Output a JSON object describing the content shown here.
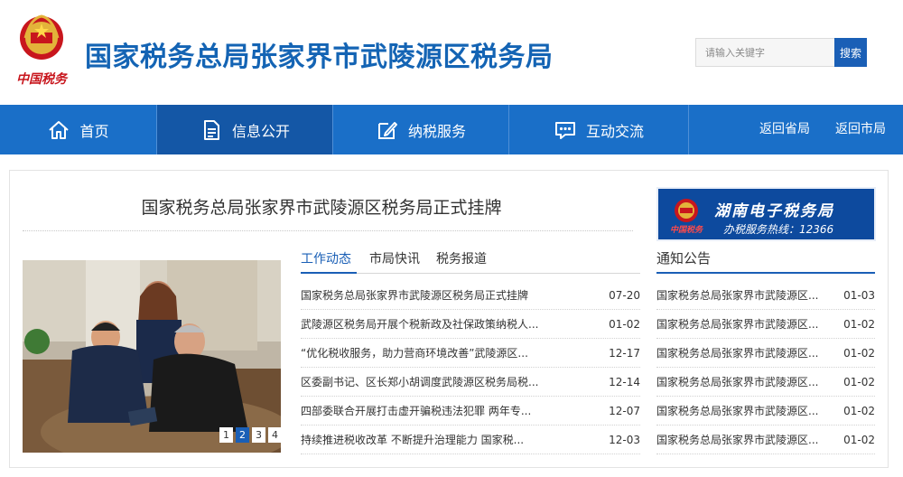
{
  "header": {
    "emblem_text": "中国税务",
    "title": "国家税务总局张家界市武陵源区税务局",
    "search_placeholder": "请输入关键字",
    "search_button": "搜索"
  },
  "nav": {
    "items": [
      {
        "label": "首页",
        "icon": "home-icon"
      },
      {
        "label": "信息公开",
        "icon": "document-icon"
      },
      {
        "label": "纳税服务",
        "icon": "edit-icon"
      },
      {
        "label": "互动交流",
        "icon": "chat-icon"
      }
    ],
    "links": [
      "返回省局",
      "返回市局"
    ]
  },
  "main": {
    "headline": "国家税务总局张家界市武陵源区税务局正式挂牌",
    "banner": {
      "logo_text": "中国税务",
      "title": "湖南电子税务局",
      "hotline": "办税服务热线：12366"
    },
    "slider": {
      "pages": [
        "1",
        "2",
        "3",
        "4"
      ],
      "active": 1
    },
    "tabs": [
      "工作动态",
      "市局快讯",
      "税务报道"
    ],
    "news": [
      {
        "title": "国家税务总局张家界市武陵源区税务局正式挂牌",
        "date": "07-20"
      },
      {
        "title": "武陵源区税务局开展个税新政及社保政策纳税人...",
        "date": "01-02"
      },
      {
        "title": "“优化税收服务，助力营商环境改善”武陵源区...",
        "date": "12-17"
      },
      {
        "title": "区委副书记、区长郑小胡调度武陵源区税务局税...",
        "date": "12-14"
      },
      {
        "title": "四部委联合开展打击虚开骗税违法犯罪 两年专...",
        "date": "12-07"
      },
      {
        "title": "持续推进税收改革 不断提升治理能力 国家税...",
        "date": "12-03"
      }
    ],
    "notices": {
      "title": "通知公告",
      "items": [
        {
          "title": "国家税务总局张家界市武陵源区...",
          "date": "01-03"
        },
        {
          "title": "国家税务总局张家界市武陵源区...",
          "date": "01-02"
        },
        {
          "title": "国家税务总局张家界市武陵源区...",
          "date": "01-02"
        },
        {
          "title": "国家税务总局张家界市武陵源区...",
          "date": "01-02"
        },
        {
          "title": "国家税务总局张家界市武陵源区...",
          "date": "01-02"
        },
        {
          "title": "国家税务总局张家界市武陵源区...",
          "date": "01-02"
        }
      ]
    }
  },
  "colors": {
    "brand_blue": "#1a6fc8",
    "title_blue": "#1464b4",
    "active_nav": "#1457a6",
    "emblem_red": "#c8161d"
  }
}
